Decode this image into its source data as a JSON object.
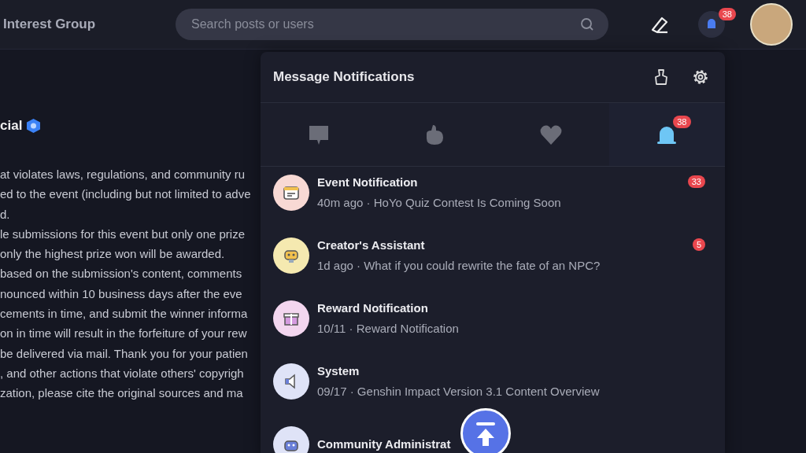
{
  "header": {
    "title": "Interest Group",
    "search": {
      "placeholder": "Search posts or users"
    },
    "notification_badge": "38"
  },
  "post": {
    "author": "cial",
    "verified": true,
    "lines": [
      "at violates laws, regulations, and community ru",
      "ed to the event (including but not limited to adve",
      "d.",
      "le submissions for this event but only one prize",
      "only the highest prize won will be awarded.",
      "based on the submission's content, comments",
      "nounced within 10 business days after the eve",
      "cements in time, and submit the winner informa",
      "on in time will result in the forfeiture of your rew",
      "be delivered via mail. Thank you for your patien",
      ", and other actions that violate others' copyrigh",
      "zation, please cite the original sources and ma"
    ]
  },
  "panel": {
    "title": "Message Notifications",
    "tabs": [
      {
        "kind": "comment",
        "selected": false
      },
      {
        "kind": "like",
        "selected": false
      },
      {
        "kind": "follow",
        "selected": false
      },
      {
        "kind": "notice",
        "selected": true,
        "badge": "38"
      }
    ],
    "items": [
      {
        "kind": "calendar",
        "title": "Event Notification",
        "summary": "40m ago · HoYo Quiz Contest Is Coming Soon",
        "badge": "33"
      },
      {
        "kind": "robot",
        "title": "Creator's Assistant",
        "summary": "1d ago · What if you could rewrite the fate of an NPC?",
        "badge": "5"
      },
      {
        "kind": "gift",
        "title": "Reward Notification",
        "summary": "10/11 · Reward Notification"
      },
      {
        "kind": "speaker",
        "title": "System",
        "summary": "09/17 · Genshin Impact Version 3.1 Content Overview"
      },
      {
        "kind": "admin",
        "title": "Community Administrat"
      }
    ]
  }
}
